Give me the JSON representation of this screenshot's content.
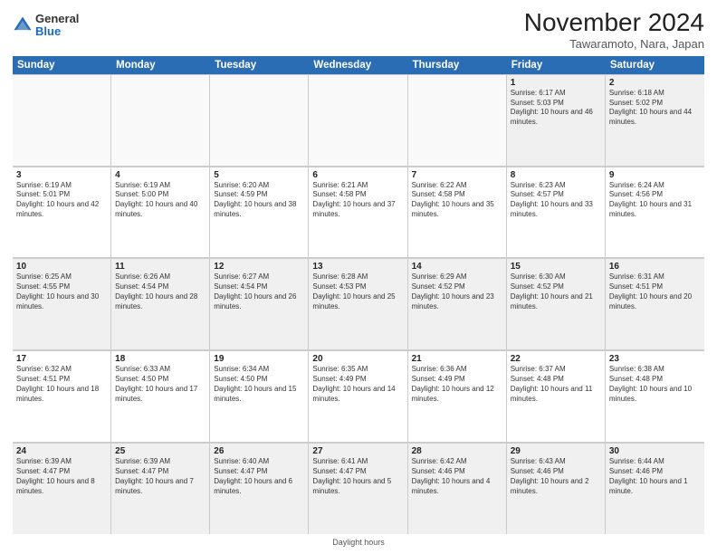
{
  "logo": {
    "general": "General",
    "blue": "Blue"
  },
  "title": "November 2024",
  "location": "Tawaramoto, Nara, Japan",
  "days_of_week": [
    "Sunday",
    "Monday",
    "Tuesday",
    "Wednesday",
    "Thursday",
    "Friday",
    "Saturday"
  ],
  "footer": "Daylight hours",
  "weeks": [
    [
      {
        "day": "",
        "info": "",
        "empty": true
      },
      {
        "day": "",
        "info": "",
        "empty": true
      },
      {
        "day": "",
        "info": "",
        "empty": true
      },
      {
        "day": "",
        "info": "",
        "empty": true
      },
      {
        "day": "",
        "info": "",
        "empty": true
      },
      {
        "day": "1",
        "info": "Sunrise: 6:17 AM\nSunset: 5:03 PM\nDaylight: 10 hours and 46 minutes."
      },
      {
        "day": "2",
        "info": "Sunrise: 6:18 AM\nSunset: 5:02 PM\nDaylight: 10 hours and 44 minutes."
      }
    ],
    [
      {
        "day": "3",
        "info": "Sunrise: 6:19 AM\nSunset: 5:01 PM\nDaylight: 10 hours and 42 minutes."
      },
      {
        "day": "4",
        "info": "Sunrise: 6:19 AM\nSunset: 5:00 PM\nDaylight: 10 hours and 40 minutes."
      },
      {
        "day": "5",
        "info": "Sunrise: 6:20 AM\nSunset: 4:59 PM\nDaylight: 10 hours and 38 minutes."
      },
      {
        "day": "6",
        "info": "Sunrise: 6:21 AM\nSunset: 4:58 PM\nDaylight: 10 hours and 37 minutes."
      },
      {
        "day": "7",
        "info": "Sunrise: 6:22 AM\nSunset: 4:58 PM\nDaylight: 10 hours and 35 minutes."
      },
      {
        "day": "8",
        "info": "Sunrise: 6:23 AM\nSunset: 4:57 PM\nDaylight: 10 hours and 33 minutes."
      },
      {
        "day": "9",
        "info": "Sunrise: 6:24 AM\nSunset: 4:56 PM\nDaylight: 10 hours and 31 minutes."
      }
    ],
    [
      {
        "day": "10",
        "info": "Sunrise: 6:25 AM\nSunset: 4:55 PM\nDaylight: 10 hours and 30 minutes."
      },
      {
        "day": "11",
        "info": "Sunrise: 6:26 AM\nSunset: 4:54 PM\nDaylight: 10 hours and 28 minutes."
      },
      {
        "day": "12",
        "info": "Sunrise: 6:27 AM\nSunset: 4:54 PM\nDaylight: 10 hours and 26 minutes."
      },
      {
        "day": "13",
        "info": "Sunrise: 6:28 AM\nSunset: 4:53 PM\nDaylight: 10 hours and 25 minutes."
      },
      {
        "day": "14",
        "info": "Sunrise: 6:29 AM\nSunset: 4:52 PM\nDaylight: 10 hours and 23 minutes."
      },
      {
        "day": "15",
        "info": "Sunrise: 6:30 AM\nSunset: 4:52 PM\nDaylight: 10 hours and 21 minutes."
      },
      {
        "day": "16",
        "info": "Sunrise: 6:31 AM\nSunset: 4:51 PM\nDaylight: 10 hours and 20 minutes."
      }
    ],
    [
      {
        "day": "17",
        "info": "Sunrise: 6:32 AM\nSunset: 4:51 PM\nDaylight: 10 hours and 18 minutes."
      },
      {
        "day": "18",
        "info": "Sunrise: 6:33 AM\nSunset: 4:50 PM\nDaylight: 10 hours and 17 minutes."
      },
      {
        "day": "19",
        "info": "Sunrise: 6:34 AM\nSunset: 4:50 PM\nDaylight: 10 hours and 15 minutes."
      },
      {
        "day": "20",
        "info": "Sunrise: 6:35 AM\nSunset: 4:49 PM\nDaylight: 10 hours and 14 minutes."
      },
      {
        "day": "21",
        "info": "Sunrise: 6:36 AM\nSunset: 4:49 PM\nDaylight: 10 hours and 12 minutes."
      },
      {
        "day": "22",
        "info": "Sunrise: 6:37 AM\nSunset: 4:48 PM\nDaylight: 10 hours and 11 minutes."
      },
      {
        "day": "23",
        "info": "Sunrise: 6:38 AM\nSunset: 4:48 PM\nDaylight: 10 hours and 10 minutes."
      }
    ],
    [
      {
        "day": "24",
        "info": "Sunrise: 6:39 AM\nSunset: 4:47 PM\nDaylight: 10 hours and 8 minutes."
      },
      {
        "day": "25",
        "info": "Sunrise: 6:39 AM\nSunset: 4:47 PM\nDaylight: 10 hours and 7 minutes."
      },
      {
        "day": "26",
        "info": "Sunrise: 6:40 AM\nSunset: 4:47 PM\nDaylight: 10 hours and 6 minutes."
      },
      {
        "day": "27",
        "info": "Sunrise: 6:41 AM\nSunset: 4:47 PM\nDaylight: 10 hours and 5 minutes."
      },
      {
        "day": "28",
        "info": "Sunrise: 6:42 AM\nSunset: 4:46 PM\nDaylight: 10 hours and 4 minutes."
      },
      {
        "day": "29",
        "info": "Sunrise: 6:43 AM\nSunset: 4:46 PM\nDaylight: 10 hours and 2 minutes."
      },
      {
        "day": "30",
        "info": "Sunrise: 6:44 AM\nSunset: 4:46 PM\nDaylight: 10 hours and 1 minute."
      }
    ]
  ]
}
